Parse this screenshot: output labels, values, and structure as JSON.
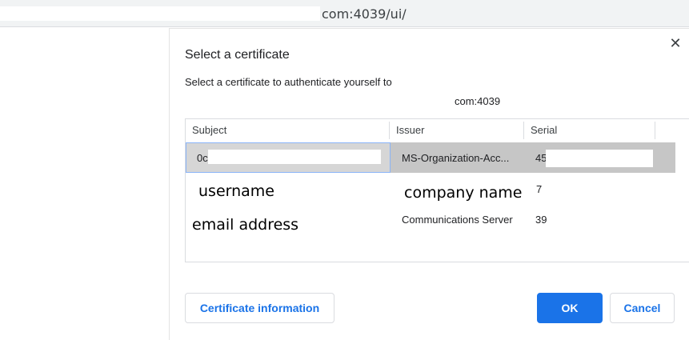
{
  "browser": {
    "url_fragment": "com:4039/ui/"
  },
  "dialog": {
    "title": "Select a certificate",
    "subtitle": "Select a certificate to authenticate yourself to",
    "site": "com:4039",
    "close_glyph": "✕"
  },
  "table": {
    "columns": [
      "Subject",
      "Issuer",
      "Serial"
    ],
    "rows": [
      {
        "subject": "0c",
        "issuer": "MS-Organization-Acc...",
        "serial": "45"
      },
      {
        "subject": "username",
        "issuer": "company name",
        "serial": "7"
      },
      {
        "subject": "email address",
        "issuer": "Communications Server",
        "serial": "39"
      }
    ]
  },
  "buttons": {
    "cert_info": "Certificate information",
    "ok": "OK",
    "cancel": "Cancel"
  },
  "colors": {
    "accent": "#1a73e8",
    "selected_row": "#c6c6c6"
  }
}
